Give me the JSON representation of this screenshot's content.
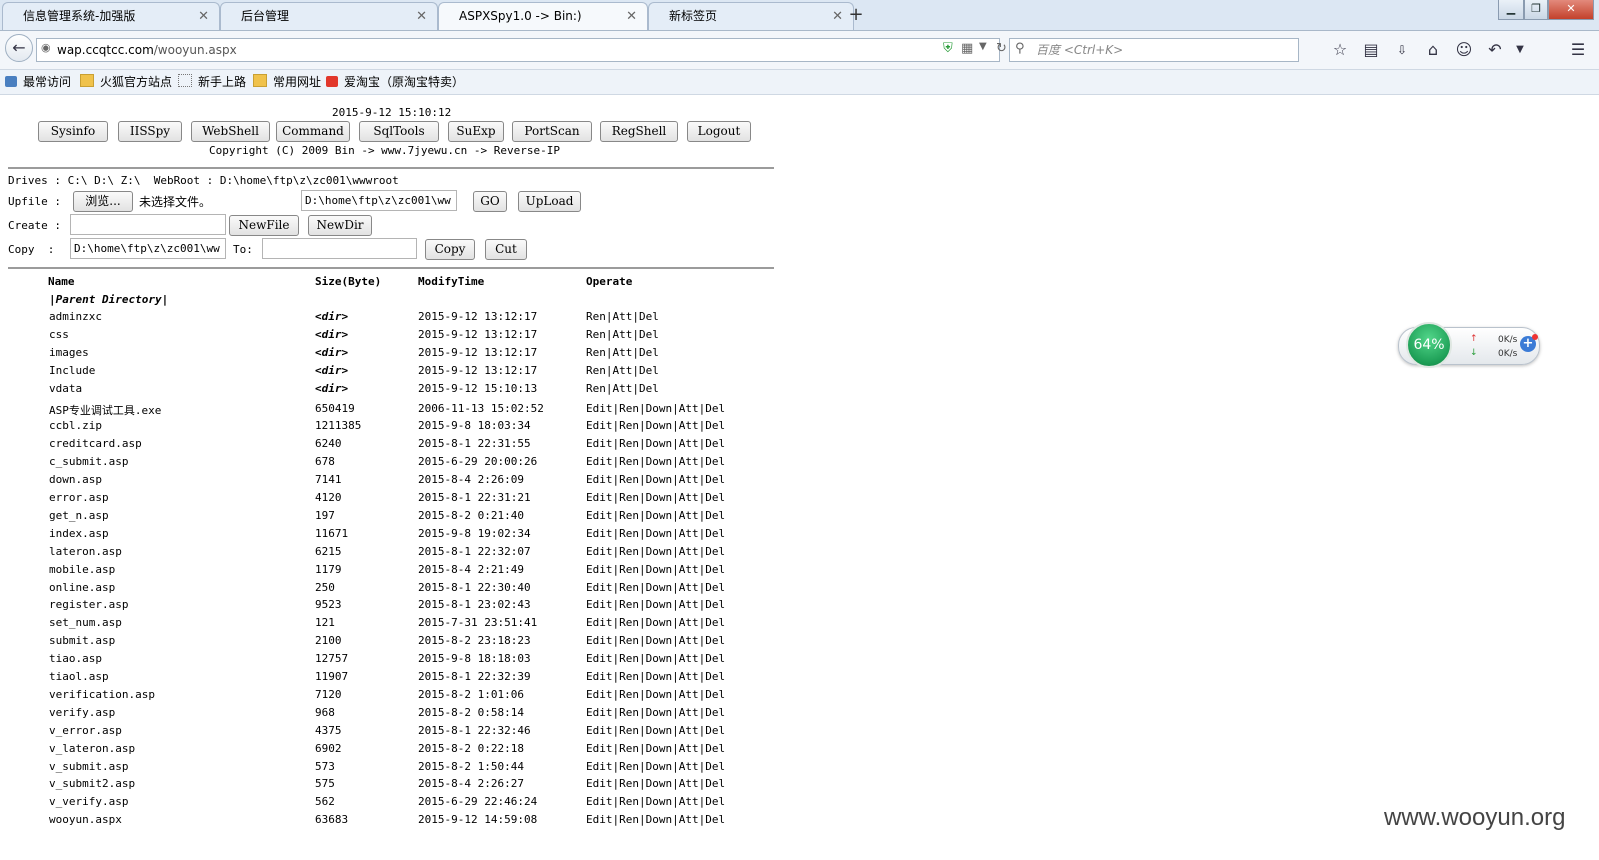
{
  "browser": {
    "tabs": [
      {
        "title": "信息管理系统-加强版",
        "active": false
      },
      {
        "title": "后台管理",
        "active": false
      },
      {
        "title": "ASPXSpy1.0 -> Bin:)",
        "active": true
      },
      {
        "title": "新标签页",
        "active": false
      }
    ],
    "url_host": "wap.ccqtcc.com",
    "url_path": "/wooyun.aspx",
    "search_placeholder": "百度 <Ctrl+K>",
    "bookmarks": [
      "最常访问",
      "火狐官方站点",
      "新手上路",
      "常用网址",
      "爱淘宝（原淘宝特卖）"
    ]
  },
  "page": {
    "datetime": "2015-9-12 15:10:12",
    "nav_buttons": [
      "Sysinfo",
      "IISSpy",
      "WebShell",
      "Command",
      "SqlTools",
      "SuExp",
      "PortScan",
      "RegShell",
      "Logout"
    ],
    "copyright": "Copyright (C) 2009 Bin -> www.7jyewu.cn -> Reverse-IP",
    "drives_line": "Drives : C:\\ D:\\ Z:\\  WebRoot : D:\\home\\ftp\\z\\zc001\\wwwroot",
    "upfile_label": "Upfile :",
    "browse_label": "浏览...",
    "no_file_text": "未选择文件。",
    "upload_path": "D:\\home\\ftp\\z\\zc001\\ww",
    "go_label": "GO",
    "upload_label": "UpLoad",
    "create_label": "Create :",
    "create_value": "",
    "newfile_label": "NewFile",
    "newdir_label": "NewDir",
    "copy_label": "Copy  :",
    "copy_value": "D:\\home\\ftp\\z\\zc001\\ww",
    "to_label": "To:",
    "to_value": "",
    "copy_btn": "Copy",
    "cut_btn": "Cut",
    "table_headers": [
      "Name",
      "Size(Byte)",
      "ModifyTime",
      "Operate"
    ],
    "parent_dir": "|Parent Directory|",
    "rows": [
      {
        "name": "adminzxc",
        "size": "<dir>",
        "time": "2015-9-12 13:12:17",
        "op": "Ren|Att|Del"
      },
      {
        "name": "css",
        "size": "<dir>",
        "time": "2015-9-12 13:12:17",
        "op": "Ren|Att|Del"
      },
      {
        "name": "images",
        "size": "<dir>",
        "time": "2015-9-12 13:12:17",
        "op": "Ren|Att|Del"
      },
      {
        "name": "Include",
        "size": "<dir>",
        "time": "2015-9-12 13:12:17",
        "op": "Ren|Att|Del"
      },
      {
        "name": "vdata",
        "size": "<dir>",
        "time": "2015-9-12 15:10:13",
        "op": "Ren|Att|Del"
      },
      {
        "name": "ASP专业调试工具.exe",
        "size": "650419",
        "time": "2006-11-13 15:02:52",
        "op": "Edit|Ren|Down|Att|Del"
      },
      {
        "name": "ccbl.zip",
        "size": "1211385",
        "time": "2015-9-8 18:03:34",
        "op": "Edit|Ren|Down|Att|Del"
      },
      {
        "name": "creditcard.asp",
        "size": "6240",
        "time": "2015-8-1 22:31:55",
        "op": "Edit|Ren|Down|Att|Del"
      },
      {
        "name": "c_submit.asp",
        "size": "678",
        "time": "2015-6-29 20:00:26",
        "op": "Edit|Ren|Down|Att|Del"
      },
      {
        "name": "down.asp",
        "size": "7141",
        "time": "2015-8-4 2:26:09",
        "op": "Edit|Ren|Down|Att|Del"
      },
      {
        "name": "error.asp",
        "size": "4120",
        "time": "2015-8-1 22:31:21",
        "op": "Edit|Ren|Down|Att|Del"
      },
      {
        "name": "get_n.asp",
        "size": "197",
        "time": "2015-8-2 0:21:40",
        "op": "Edit|Ren|Down|Att|Del"
      },
      {
        "name": "index.asp",
        "size": "11671",
        "time": "2015-9-8 19:02:34",
        "op": "Edit|Ren|Down|Att|Del"
      },
      {
        "name": "lateron.asp",
        "size": "6215",
        "time": "2015-8-1 22:32:07",
        "op": "Edit|Ren|Down|Att|Del"
      },
      {
        "name": "mobile.asp",
        "size": "1179",
        "time": "2015-8-4 2:21:49",
        "op": "Edit|Ren|Down|Att|Del"
      },
      {
        "name": "online.asp",
        "size": "250",
        "time": "2015-8-1 22:30:40",
        "op": "Edit|Ren|Down|Att|Del"
      },
      {
        "name": "register.asp",
        "size": "9523",
        "time": "2015-8-1 23:02:43",
        "op": "Edit|Ren|Down|Att|Del"
      },
      {
        "name": "set_num.asp",
        "size": "121",
        "time": "2015-7-31 23:51:41",
        "op": "Edit|Ren|Down|Att|Del"
      },
      {
        "name": "submit.asp",
        "size": "2100",
        "time": "2015-8-2 23:18:23",
        "op": "Edit|Ren|Down|Att|Del"
      },
      {
        "name": "tiao.asp",
        "size": "12757",
        "time": "2015-9-8 18:18:03",
        "op": "Edit|Ren|Down|Att|Del"
      },
      {
        "name": "tiaol.asp",
        "size": "11907",
        "time": "2015-8-1 22:32:39",
        "op": "Edit|Ren|Down|Att|Del"
      },
      {
        "name": "verification.asp",
        "size": "7120",
        "time": "2015-8-2 1:01:06",
        "op": "Edit|Ren|Down|Att|Del"
      },
      {
        "name": "verify.asp",
        "size": "968",
        "time": "2015-8-2 0:58:14",
        "op": "Edit|Ren|Down|Att|Del"
      },
      {
        "name": "v_error.asp",
        "size": "4375",
        "time": "2015-8-1 22:32:46",
        "op": "Edit|Ren|Down|Att|Del"
      },
      {
        "name": "v_lateron.asp",
        "size": "6902",
        "time": "2015-8-2 0:22:18",
        "op": "Edit|Ren|Down|Att|Del"
      },
      {
        "name": "v_submit.asp",
        "size": "573",
        "time": "2015-8-2 1:50:44",
        "op": "Edit|Ren|Down|Att|Del"
      },
      {
        "name": "v_submit2.asp",
        "size": "575",
        "time": "2015-8-4 2:26:27",
        "op": "Edit|Ren|Down|Att|Del"
      },
      {
        "name": "v_verify.asp",
        "size": "562",
        "time": "2015-6-29 22:46:24",
        "op": "Edit|Ren|Down|Att|Del"
      },
      {
        "name": "wooyun.aspx",
        "size": "63683",
        "time": "2015-9-12 14:59:08",
        "op": "Edit|Ren|Down|Att|Del"
      }
    ]
  },
  "widget": {
    "percent": "64%",
    "up": "0K/s",
    "down": "0K/s"
  },
  "watermark": "www.wooyun.org",
  "colors": {
    "widget_green": "#1d9e56",
    "tab_bg": "#dce7f3"
  }
}
